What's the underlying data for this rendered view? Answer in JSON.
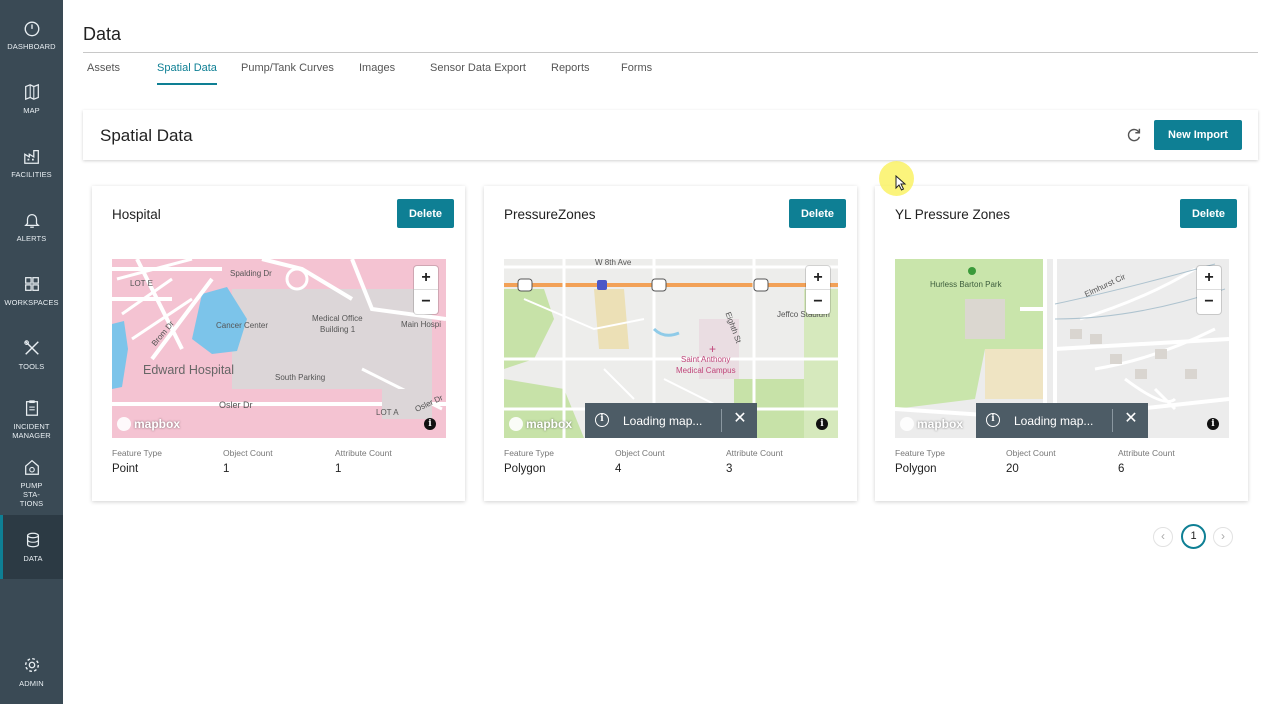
{
  "sidebar": {
    "items": [
      {
        "label": "DASHBOARD",
        "icon": "dashboard-icon"
      },
      {
        "label": "MAP",
        "icon": "map-icon"
      },
      {
        "label": "FACILITIES",
        "icon": "factory-icon"
      },
      {
        "label": "ALERTS",
        "icon": "bell-icon"
      },
      {
        "label": "WORKSPACES",
        "icon": "grid-icon"
      },
      {
        "label": "TOOLS",
        "icon": "tools-icon"
      },
      {
        "label": "INCIDENT MANAGER",
        "icon": "clipboard-icon"
      },
      {
        "label": "PUMP STA- TIONS",
        "icon": "pump-house-icon"
      },
      {
        "label": "DATA",
        "icon": "database-icon",
        "active": true
      },
      {
        "label": "ADMIN",
        "icon": "gear-icon"
      }
    ]
  },
  "header": {
    "title": "Data",
    "tabs": [
      {
        "label": "Assets"
      },
      {
        "label": "Spatial Data",
        "active": true
      },
      {
        "label": "Pump/Tank Curves"
      },
      {
        "label": "Images"
      },
      {
        "label": "Sensor Data Export"
      },
      {
        "label": "Reports"
      },
      {
        "label": "Forms"
      }
    ]
  },
  "section": {
    "title": "Spatial Data",
    "refresh_icon": "refresh-icon",
    "new_import_label": "New Import"
  },
  "datasets": [
    {
      "name": "Hospital",
      "delete_label": "Delete",
      "feature_type_label": "Feature Type",
      "feature_type": "Point",
      "object_count_label": "Object Count",
      "object_count": "1",
      "attribute_count_label": "Attribute Count",
      "attribute_count": "1",
      "map_labels": [
        "Spalding Dr",
        "LOT E",
        "Cancer Center",
        "Medical Office",
        "Building 1",
        "Main Hospi",
        "Brom Dr",
        "Edward Hospital",
        "South Parking",
        "Osler Dr",
        "LOT A",
        "Osler Dr"
      ],
      "loading": false
    },
    {
      "name": "PressureZones",
      "delete_label": "Delete",
      "feature_type_label": "Feature Type",
      "feature_type": "Polygon",
      "object_count_label": "Object Count",
      "object_count": "4",
      "attribute_count_label": "Attribute Count",
      "attribute_count": "3",
      "map_labels": [
        "W 8th Ave",
        "Saint Anthony",
        "Medical Campus",
        "Eighth St",
        "Jeffco Stadium"
      ],
      "loading": true,
      "loading_text": "Loading map..."
    },
    {
      "name": "YL Pressure Zones",
      "delete_label": "Delete",
      "feature_type_label": "Feature Type",
      "feature_type": "Polygon",
      "object_count_label": "Object Count",
      "object_count": "20",
      "attribute_count_label": "Attribute Count",
      "attribute_count": "6",
      "map_labels": [
        "Hurless Barton Park",
        "Elmhurst Cir"
      ],
      "loading": true,
      "loading_text": "Loading map..."
    }
  ],
  "map_common": {
    "zoom_in": "+",
    "zoom_out": "−",
    "attribution": "mapbox",
    "info": "i",
    "close": "✕"
  },
  "pagination": {
    "prev": "‹",
    "page": "1",
    "next": "›"
  },
  "colors": {
    "sidebar": "#3a4a55",
    "accent": "#0e7f94"
  }
}
